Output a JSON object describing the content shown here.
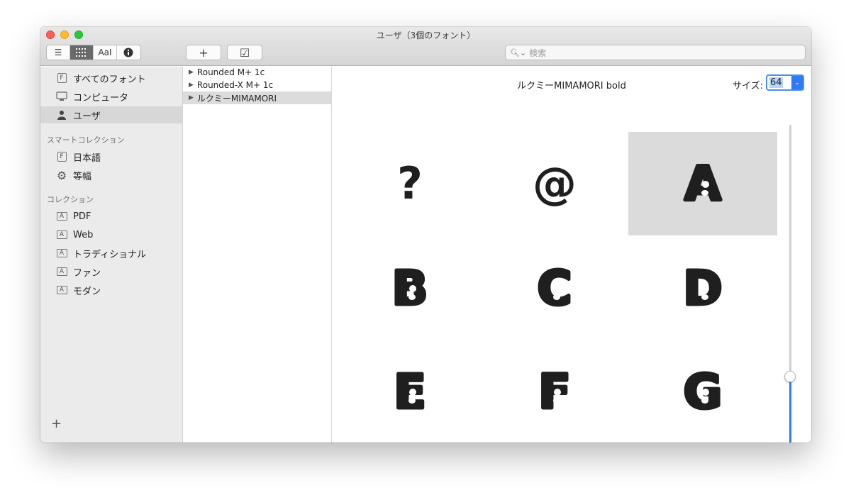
{
  "window": {
    "title": "ユーザ（3個のフォント）"
  },
  "toolbar": {
    "view_modes": [
      {
        "name": "list-view-icon",
        "glyph": "☰"
      },
      {
        "name": "grid-view-icon",
        "glyph": "⠿"
      },
      {
        "name": "sample-view-icon",
        "glyph": "AaI"
      },
      {
        "name": "info-view-icon",
        "glyph": "ℹ"
      }
    ],
    "add_label": "+",
    "validate_label": "☑",
    "search_placeholder": "検索"
  },
  "sidebar": {
    "items": [
      {
        "label": "すべてのフォント",
        "icon": "F"
      },
      {
        "label": "コンピュータ",
        "icon": "computer-icon"
      },
      {
        "label": "ユーザ",
        "icon": "user-icon"
      }
    ],
    "smart_header": "スマートコレクション",
    "smart_items": [
      {
        "label": "日本語",
        "icon": "F"
      },
      {
        "label": "等幅",
        "icon": "gear-icon"
      }
    ],
    "collections_header": "コレクション",
    "collections": [
      {
        "label": "PDF",
        "icon": "A"
      },
      {
        "label": "Web",
        "icon": "A"
      },
      {
        "label": "トラディショナル",
        "icon": "A"
      },
      {
        "label": "ファン",
        "icon": "A"
      },
      {
        "label": "モダン",
        "icon": "A"
      }
    ],
    "add_label": "+"
  },
  "fontlist": {
    "rows": [
      {
        "label": "Rounded M+ 1c"
      },
      {
        "label": "Rounded-X M+ 1c"
      },
      {
        "label": "ルクミーMIMAMORI"
      }
    ]
  },
  "preview": {
    "font_name": "ルクミーMIMAMORI bold",
    "size_label": "サイズ:",
    "size_value": "64",
    "glyphs": [
      "?",
      "@",
      "A",
      "B",
      "C",
      "D",
      "E",
      "F",
      "G"
    ],
    "colors": {
      "glyph": "#1f1f1f",
      "selection": "#dbdbdb",
      "accent": "#2f7bf5"
    }
  }
}
